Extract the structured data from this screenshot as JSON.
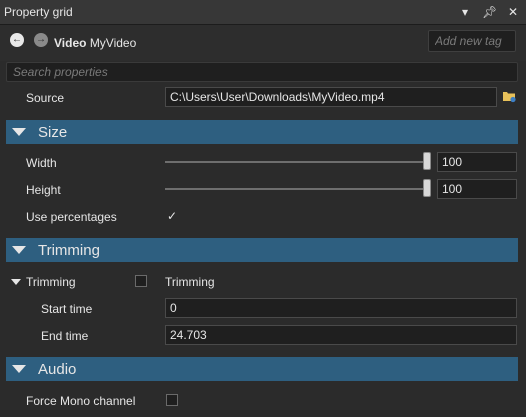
{
  "window": {
    "title": "Property grid",
    "icons": [
      "dropdown-icon",
      "pin-icon",
      "close-icon"
    ]
  },
  "header": {
    "asset_type": "Video",
    "asset_name": "MyVideo",
    "tag_placeholder": "Add new tag"
  },
  "search": {
    "placeholder": "Search properties"
  },
  "source": {
    "label": "Source",
    "value": "C:\\Users\\User\\Downloads\\MyVideo.mp4"
  },
  "sections": {
    "size": {
      "title": "Size",
      "width": {
        "label": "Width",
        "value": "100",
        "slider_level": 1.0
      },
      "height": {
        "label": "Height",
        "value": "100",
        "slider_level": 1.0
      },
      "use_percentages": {
        "label": "Use percentages",
        "checked": true
      }
    },
    "trimming": {
      "title": "Trimming",
      "toggle": {
        "label": "Trimming",
        "checkbox_label": "Trimming",
        "checked": false
      },
      "start_time": {
        "label": "Start time",
        "value": "0"
      },
      "end_time": {
        "label": "End time",
        "value": "24.703"
      }
    },
    "audio": {
      "title": "Audio",
      "force_mono": {
        "label": "Force Mono channel",
        "checked": false
      }
    }
  }
}
